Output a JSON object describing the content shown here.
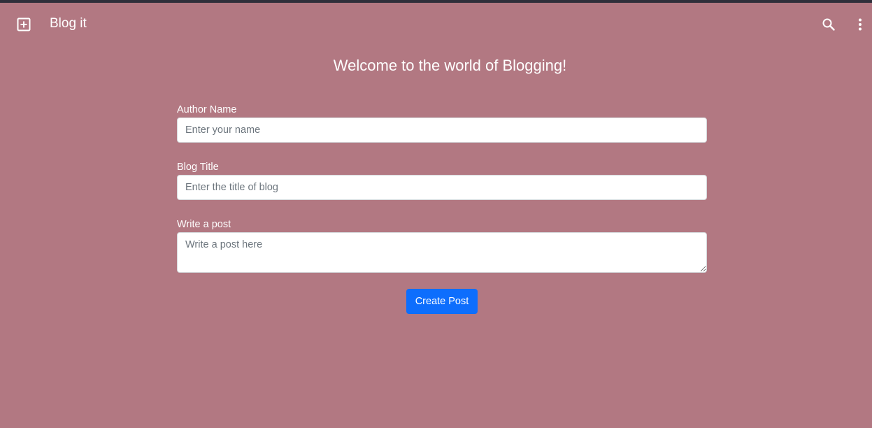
{
  "appbar": {
    "title": "Blog it",
    "add_icon": "add-box-icon",
    "search_icon": "search-icon",
    "more_icon": "more-vertical-icon"
  },
  "main": {
    "heading": "Welcome to the world of Blogging!"
  },
  "form": {
    "author": {
      "label": "Author Name",
      "placeholder": "Enter your name",
      "value": ""
    },
    "title": {
      "label": "Blog Title",
      "placeholder": "Enter the title of blog",
      "value": ""
    },
    "post": {
      "label": "Write a post",
      "placeholder": "Write a post here",
      "value": ""
    },
    "submit_label": "Create Post"
  },
  "colors": {
    "background": "#b27882",
    "top_strip": "#2f2f3a",
    "primary_button": "#0d6efd",
    "text": "#ffffff"
  }
}
